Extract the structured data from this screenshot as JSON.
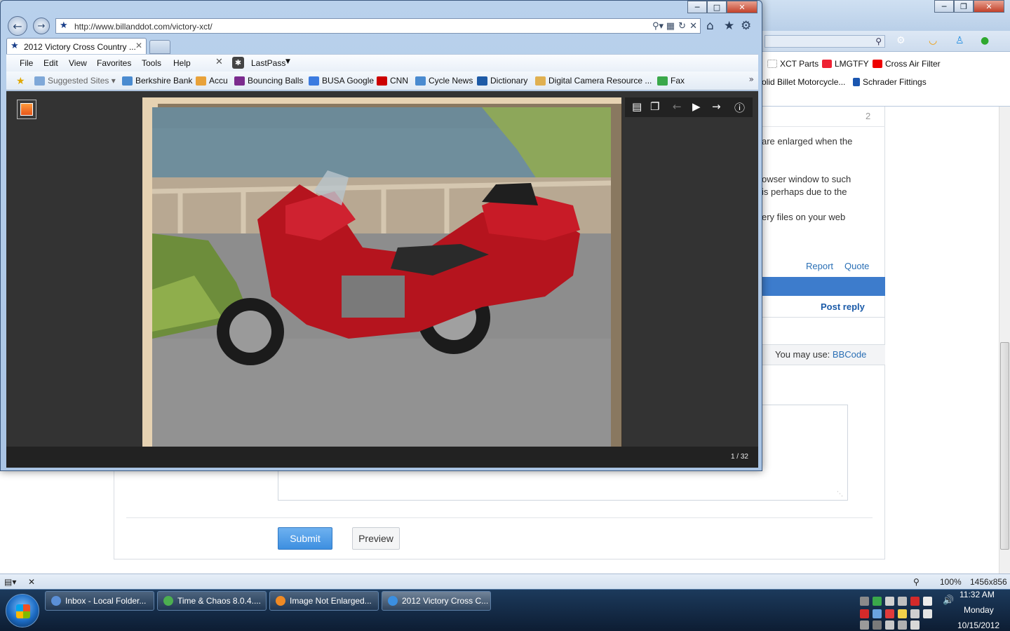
{
  "background_browser": {
    "bookmarks": [
      {
        "label": "XCT Parts"
      },
      {
        "label": "LMGTFY"
      },
      {
        "label": "Cross Air Filter"
      },
      {
        "label": "olid Billet Motorcycle..."
      },
      {
        "label": "Schrader Fittings"
      }
    ],
    "post": {
      "number": "2",
      "lines": [
        "are enlarged when the",
        "owser window to such",
        "is perhaps due to the",
        "ery files on your web"
      ],
      "report_label": "Report",
      "quote_label": "Quote"
    },
    "post_reply_label": "Post reply",
    "may_use_prefix": "You may use:",
    "may_use_link": "BBCode",
    "submit_label": "Submit",
    "preview_label": "Preview",
    "status": {
      "zoom": "100%",
      "resolution": "1456x856"
    }
  },
  "ie_window": {
    "url": "http://www.billanddot.com/victory-xct/",
    "tab_title": "2012 Victory Cross Country ...",
    "menu": [
      "File",
      "Edit",
      "View",
      "Favorites",
      "Tools",
      "Help"
    ],
    "lastpass_label": "LastPass",
    "favorites": [
      {
        "label": "Suggested Sites ▾",
        "color": "#7fa8d8"
      },
      {
        "label": "Berkshire Bank",
        "color": "#4a8bd0"
      },
      {
        "label": "Accu",
        "color": "#e8a23a"
      },
      {
        "label": "Bouncing Balls",
        "color": "#7b2b8e"
      },
      {
        "label": "BUSA Google",
        "color": "#3b7be0"
      },
      {
        "label": "CNN",
        "color": "#cc0000"
      },
      {
        "label": "Cycle News",
        "color": "#4a8bd0"
      },
      {
        "label": "Dictionary",
        "color": "#1d5aa6"
      },
      {
        "label": "Digital Camera Resource ...",
        "color": "#e0b050"
      },
      {
        "label": "Fax",
        "color": "#3aa84a"
      }
    ],
    "viewer": {
      "counter": "1 / 32"
    }
  },
  "taskbar": {
    "buttons": [
      {
        "label": "Inbox - Local Folder...",
        "color": "#5b8fd6"
      },
      {
        "label": "Time & Chaos 8.0.4....",
        "color": "#4caf50"
      },
      {
        "label": "Image Not Enlarged...",
        "color": "#f08a24"
      },
      {
        "label": "2012 Victory Cross C...",
        "color": "#3b8fe0"
      }
    ],
    "clock": {
      "time": "11:32 AM",
      "day": "Monday",
      "date": "10/15/2012"
    }
  }
}
